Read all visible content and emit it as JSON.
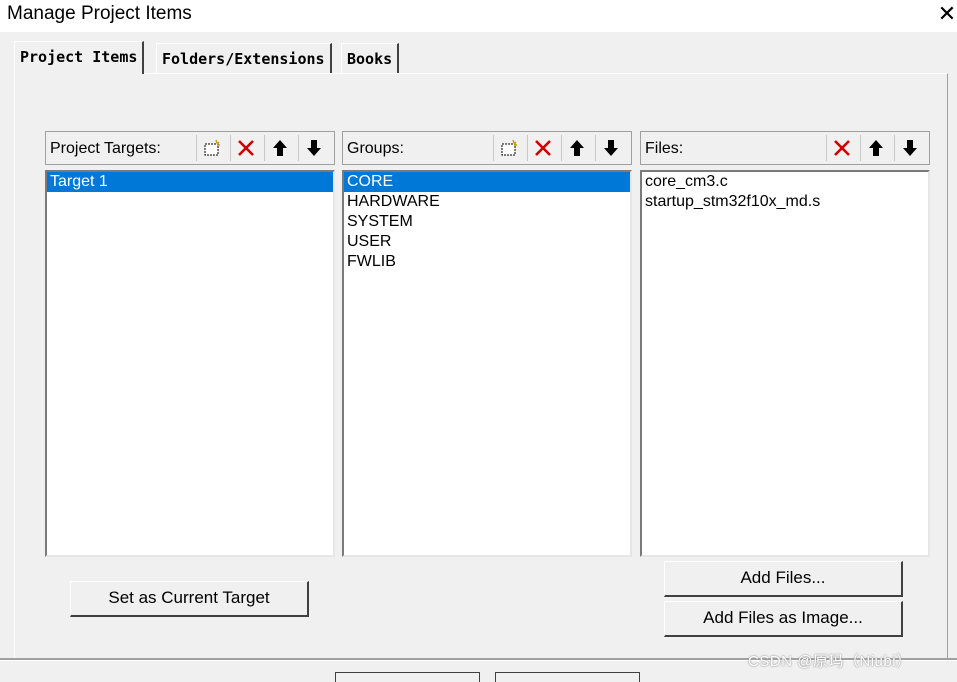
{
  "window": {
    "title": "Manage Project Items",
    "close_icon": "close-icon"
  },
  "tabs": [
    {
      "label": "Project Items",
      "active": true
    },
    {
      "label": "Folders/Extensions",
      "active": false
    },
    {
      "label": "Books",
      "active": false
    }
  ],
  "targets": {
    "header": "Project Targets:",
    "items": [
      "Target 1"
    ],
    "selected": "Target 1",
    "toolbar": [
      "new-icon",
      "delete-icon",
      "move-up-icon",
      "move-down-icon"
    ]
  },
  "groups": {
    "header": "Groups:",
    "items": [
      "CORE",
      "HARDWARE",
      "SYSTEM",
      "USER",
      "FWLIB"
    ],
    "selected": "CORE",
    "toolbar": [
      "new-icon",
      "delete-icon",
      "move-up-icon",
      "move-down-icon"
    ]
  },
  "files": {
    "header": "Files:",
    "items": [
      "core_cm3.c",
      "startup_stm32f10x_md.s"
    ],
    "toolbar": [
      "delete-icon",
      "move-up-icon",
      "move-down-icon"
    ]
  },
  "buttons": {
    "set_current_target": "Set as Current Target",
    "add_files": "Add Files...",
    "add_files_image": "Add Files as Image..."
  },
  "watermark": "CSDN @原玛（Niubi）",
  "colors": {
    "selection": "#0078d7",
    "dialog_bg": "#f0f0f0",
    "delete_red": "#d00000"
  }
}
